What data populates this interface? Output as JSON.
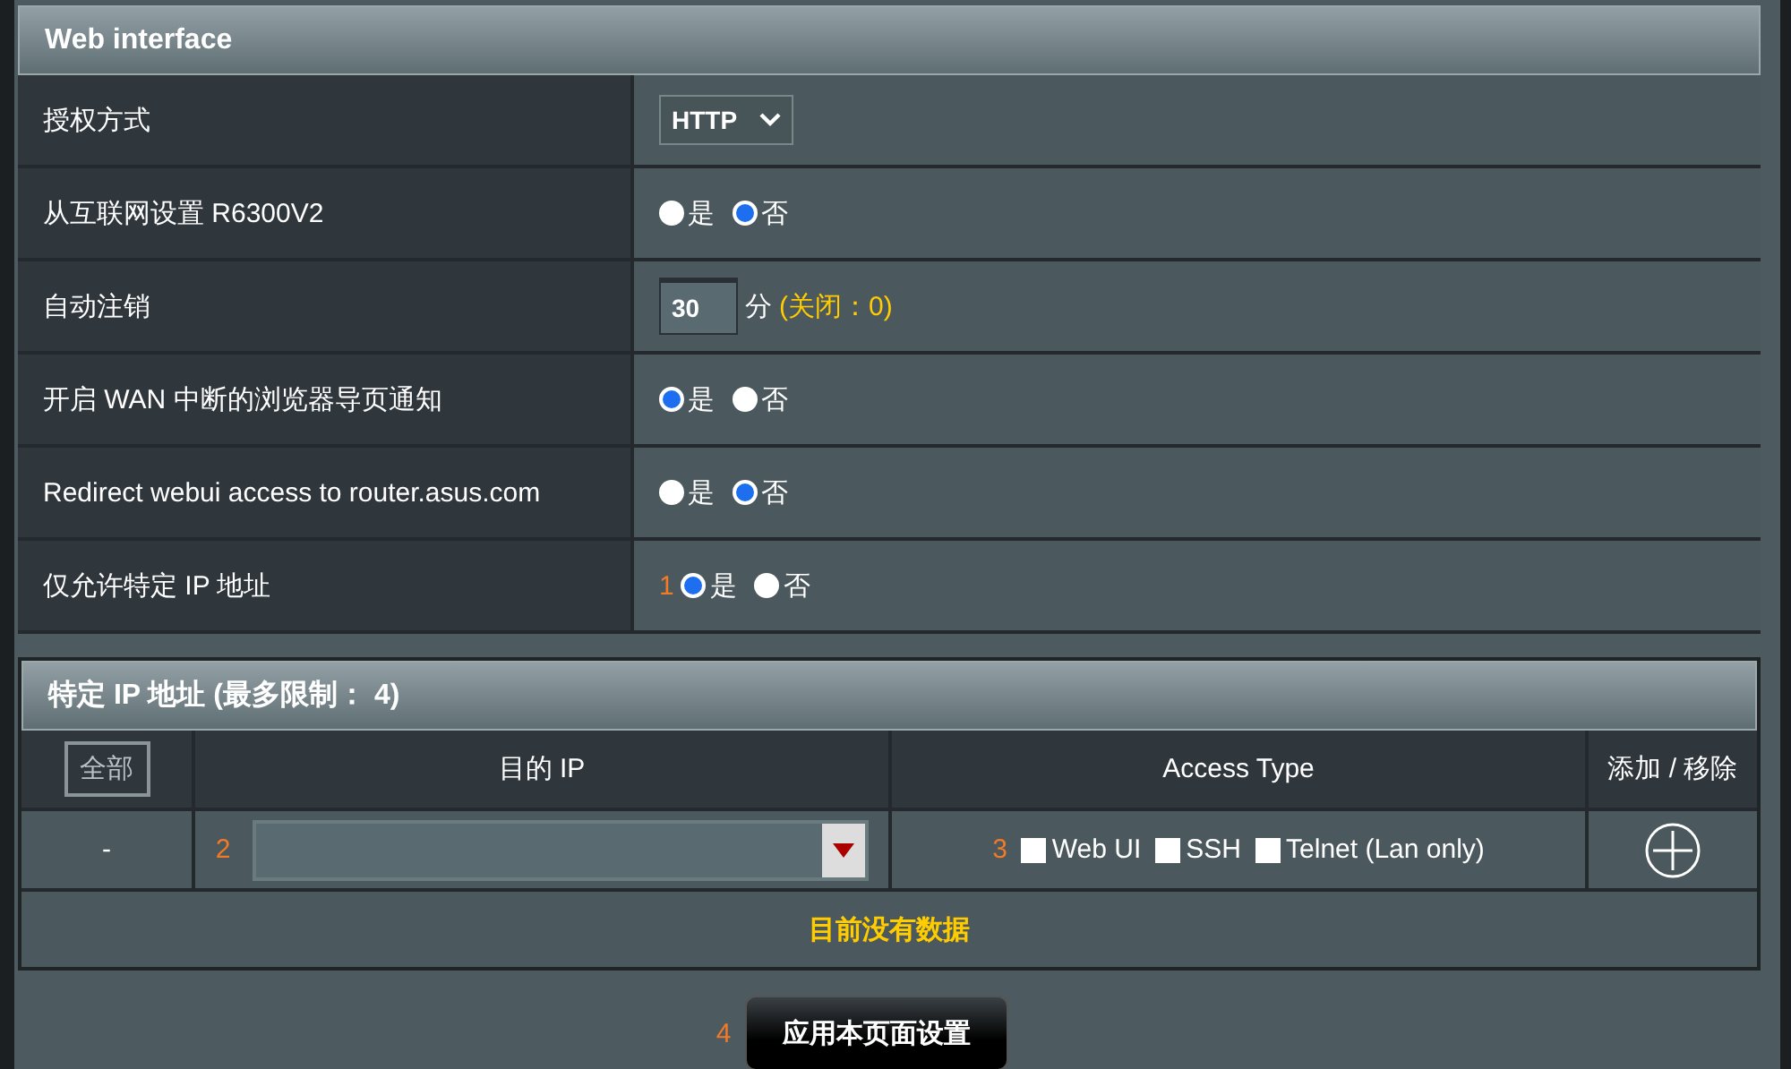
{
  "section": {
    "title": "Web interface"
  },
  "settings": [
    {
      "label": "授权方式",
      "kind": "select",
      "value": "HTTP"
    },
    {
      "label": "从互联网设置 R6300V2",
      "kind": "radio",
      "options": [
        {
          "label": "是",
          "selected": false
        },
        {
          "label": "否",
          "selected": true
        }
      ]
    },
    {
      "label": "自动注销",
      "kind": "number",
      "value": "30",
      "unit": "分",
      "note": "(关闭：0)"
    },
    {
      "label": "开启 WAN 中断的浏览器导页通知",
      "kind": "radio",
      "options": [
        {
          "label": "是",
          "selected": true
        },
        {
          "label": "否",
          "selected": false
        }
      ]
    },
    {
      "label": "Redirect webui access to router.asus.com",
      "kind": "radio",
      "options": [
        {
          "label": "是",
          "selected": false
        },
        {
          "label": "否",
          "selected": true
        }
      ]
    },
    {
      "label": "仅允许特定 IP 地址",
      "kind": "radio",
      "annotation": "1",
      "options": [
        {
          "label": "是",
          "selected": true
        },
        {
          "label": "否",
          "selected": false
        }
      ]
    }
  ],
  "ip_section": {
    "title": "特定 IP 地址 (最多限制： 4)",
    "columns": [
      {
        "kind": "button",
        "label": "全部"
      },
      {
        "kind": "text",
        "label": "目的 IP"
      },
      {
        "kind": "text",
        "label": "Access Type"
      },
      {
        "kind": "text",
        "label": "添加 / 移除"
      }
    ],
    "input_row": {
      "marker": "-",
      "ip_annotation": "2",
      "access_annotation": "3",
      "access_types": [
        {
          "label": "Web UI",
          "checked": false
        },
        {
          "label": "SSH",
          "checked": false
        },
        {
          "label": "Telnet (Lan only)",
          "checked": false
        }
      ]
    },
    "empty_message": "目前没有数据"
  },
  "apply": {
    "annotation": "4",
    "label": "应用本页面设置"
  }
}
